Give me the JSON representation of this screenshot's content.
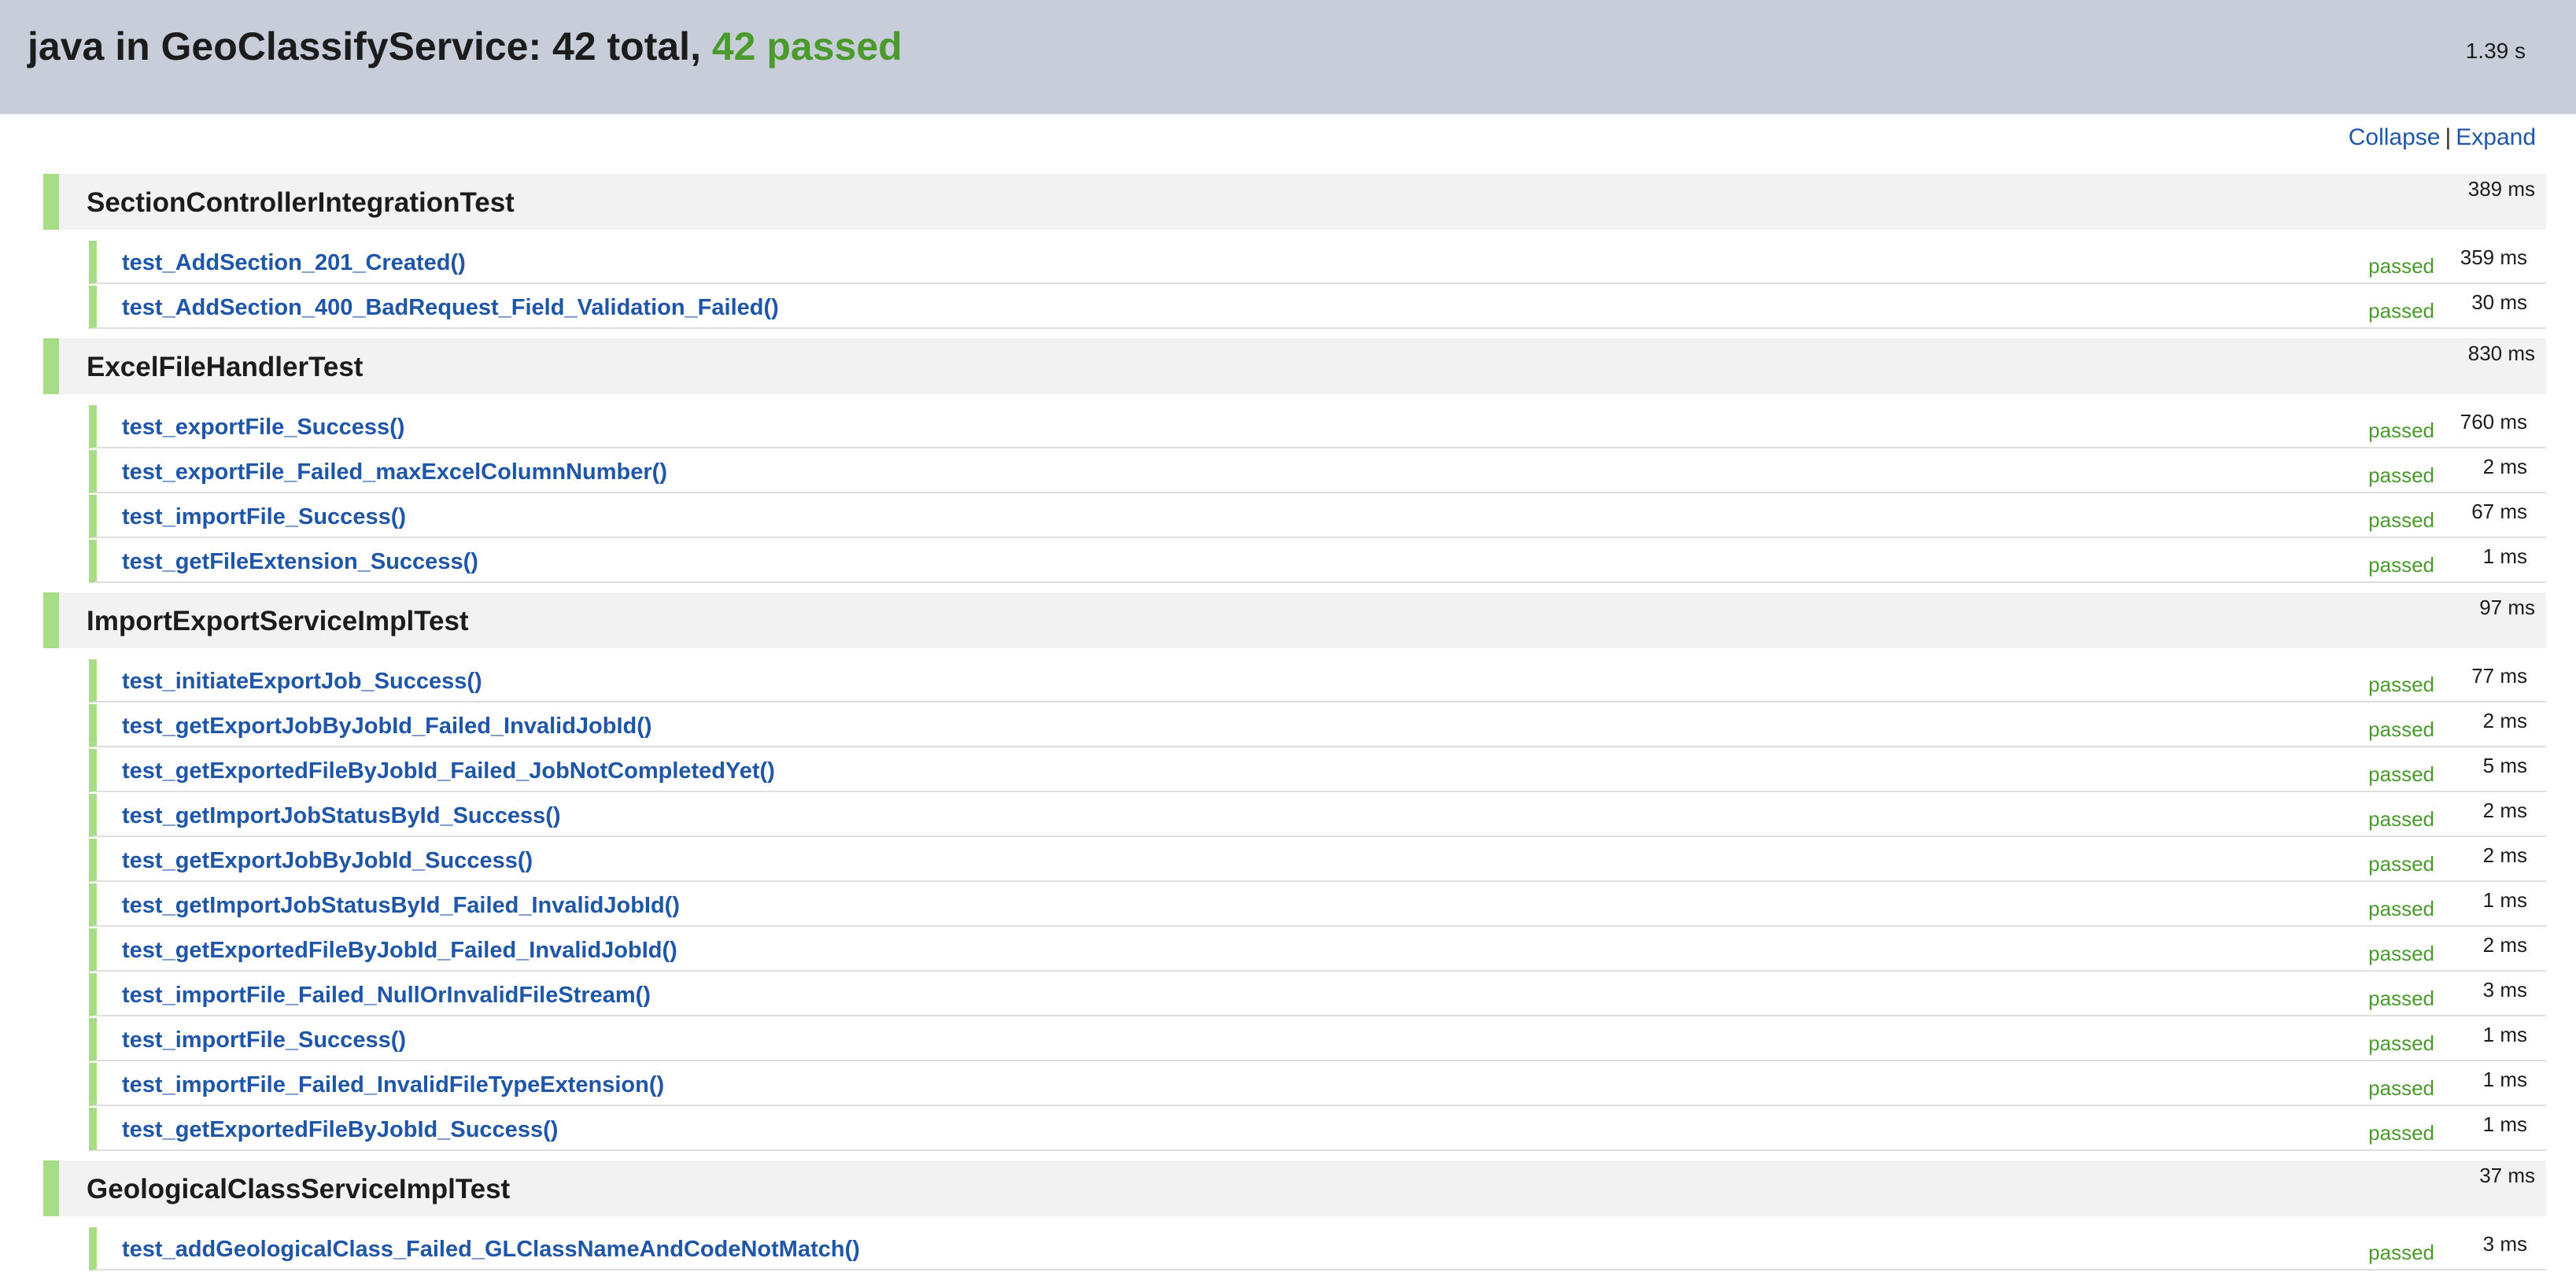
{
  "header": {
    "title_prefix": "java in GeoClassifyService: 42 total, ",
    "title_passed": "42 passed",
    "duration": "1.39 s"
  },
  "controls": {
    "collapse": "Collapse",
    "separator": "|",
    "expand": "Expand"
  },
  "suites": [
    {
      "name": "SectionControllerIntegrationTest",
      "time": "389 ms",
      "tests": [
        {
          "name": "test_AddSection_201_Created()",
          "status": "passed",
          "time": "359 ms"
        },
        {
          "name": "test_AddSection_400_BadRequest_Field_Validation_Failed()",
          "status": "passed",
          "time": "30 ms"
        }
      ]
    },
    {
      "name": "ExcelFileHandlerTest",
      "time": "830 ms",
      "tests": [
        {
          "name": "test_exportFile_Success()",
          "status": "passed",
          "time": "760 ms"
        },
        {
          "name": "test_exportFile_Failed_maxExcelColumnNumber()",
          "status": "passed",
          "time": "2 ms"
        },
        {
          "name": "test_importFile_Success()",
          "status": "passed",
          "time": "67 ms"
        },
        {
          "name": "test_getFileExtension_Success()",
          "status": "passed",
          "time": "1 ms"
        }
      ]
    },
    {
      "name": "ImportExportServiceImplTest",
      "time": "97 ms",
      "tests": [
        {
          "name": "test_initiateExportJob_Success()",
          "status": "passed",
          "time": "77 ms"
        },
        {
          "name": "test_getExportJobByJobId_Failed_InvalidJobId()",
          "status": "passed",
          "time": "2 ms"
        },
        {
          "name": "test_getExportedFileByJobId_Failed_JobNotCompletedYet()",
          "status": "passed",
          "time": "5 ms"
        },
        {
          "name": "test_getImportJobStatusById_Success()",
          "status": "passed",
          "time": "2 ms"
        },
        {
          "name": "test_getExportJobByJobId_Success()",
          "status": "passed",
          "time": "2 ms"
        },
        {
          "name": "test_getImportJobStatusById_Failed_InvalidJobId()",
          "status": "passed",
          "time": "1 ms"
        },
        {
          "name": "test_getExportedFileByJobId_Failed_InvalidJobId()",
          "status": "passed",
          "time": "2 ms"
        },
        {
          "name": "test_importFile_Failed_NullOrInvalidFileStream()",
          "status": "passed",
          "time": "3 ms"
        },
        {
          "name": "test_importFile_Success()",
          "status": "passed",
          "time": "1 ms"
        },
        {
          "name": "test_importFile_Failed_InvalidFileTypeExtension()",
          "status": "passed",
          "time": "1 ms"
        },
        {
          "name": "test_getExportedFileByJobId_Success()",
          "status": "passed",
          "time": "1 ms"
        }
      ]
    },
    {
      "name": "GeologicalClassServiceImplTest",
      "time": "37 ms",
      "tests": [
        {
          "name": "test_addGeologicalClass_Failed_GLClassNameAndCodeNotMatch()",
          "status": "passed",
          "time": "3 ms"
        }
      ]
    }
  ],
  "colors": {
    "header_bg": "#c8ced9",
    "passed_green": "#4a9a2e",
    "status_bar_green": "#a6dd86",
    "link_blue": "#1f56a8"
  }
}
